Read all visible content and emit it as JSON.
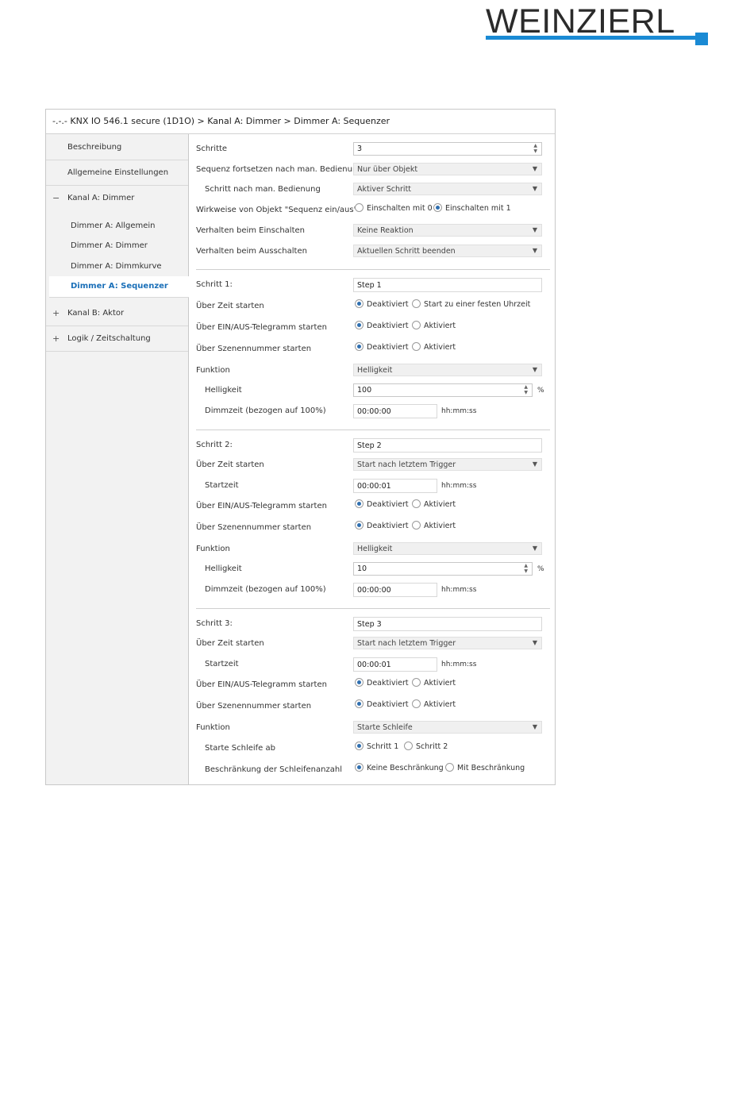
{
  "logo": {
    "text": "WEINZIERL",
    "color": "#1a8ad4"
  },
  "breadcrumb": "-.-.- KNX IO 546.1 secure (1D1O) > Kanal A: Dimmer > Dimmer A: Sequenzer",
  "sidebar": {
    "items": [
      {
        "label": "Beschreibung"
      },
      {
        "label": "Allgemeine Einstellungen"
      },
      {
        "label": "Kanal A: Dimmer",
        "toggle": "−"
      },
      {
        "label": "Dimmer A: Allgemein"
      },
      {
        "label": "Dimmer A: Dimmer"
      },
      {
        "label": "Dimmer A: Dimmkurve"
      },
      {
        "label": "Dimmer A: Sequenzer",
        "active": true
      },
      {
        "label": "Kanal B: Aktor",
        "toggle": "+"
      },
      {
        "label": "Logik / Zeitschaltung",
        "toggle": "+"
      }
    ]
  },
  "radio_labels": {
    "deaktiviert": "Deaktiviert",
    "aktiviert": "Aktiviert",
    "ein0": "Einschalten mit 0",
    "ein1": "Einschalten mit 1",
    "fixtime": "Start zu einer festen Uhrzeit",
    "schritt1": "Schritt 1",
    "schritt2": "Schritt 2",
    "keine": "Keine Beschränkung",
    "mit": "Mit Beschränkung"
  },
  "units": {
    "percent": "%",
    "time": "hh:mm:ss"
  },
  "general": {
    "schritte_label": "Schritte",
    "schritte_value": "3",
    "fortsetzen_label": "Sequenz fortsetzen nach man. Bedienung",
    "fortsetzen_value": "Nur über Objekt",
    "schritt_nach_label": "Schritt nach man. Bedienung",
    "schritt_nach_value": "Aktiver Schritt",
    "wirkweise_label": "Wirkweise von Objekt \"Sequenz ein/aus\"",
    "einschalten_label": "Verhalten beim Einschalten",
    "einschalten_value": "Keine Reaktion",
    "ausschalten_label": "Verhalten beim Ausschalten",
    "ausschalten_value": "Aktuellen Schritt beenden"
  },
  "step1": {
    "name_label": "Schritt 1:",
    "name_value": "Step 1",
    "zeit_label": "Über Zeit starten",
    "ein_aus_label": "Über EIN/AUS-Telegramm starten",
    "szene_label": "Über Szenennummer starten",
    "funktion_label": "Funktion",
    "funktion_value": "Helligkeit",
    "hell_label": "Helligkeit",
    "hell_value": "100",
    "dimm_label": "Dimmzeit (bezogen auf 100%)",
    "dimm_value": "00:00:00"
  },
  "step2": {
    "name_label": "Schritt 2:",
    "name_value": "Step 2",
    "zeit_label": "Über Zeit starten",
    "zeit_value": "Start nach letztem Trigger",
    "start_label": "Startzeit",
    "start_value": "00:00:01",
    "ein_aus_label": "Über EIN/AUS-Telegramm starten",
    "szene_label": "Über Szenennummer starten",
    "funktion_label": "Funktion",
    "funktion_value": "Helligkeit",
    "hell_label": "Helligkeit",
    "hell_value": "10",
    "dimm_label": "Dimmzeit (bezogen auf 100%)",
    "dimm_value": "00:00:00"
  },
  "step3": {
    "name_label": "Schritt 3:",
    "name_value": "Step 3",
    "zeit_label": "Über Zeit starten",
    "zeit_value": "Start nach letztem Trigger",
    "start_label": "Startzeit",
    "start_value": "00:00:01",
    "ein_aus_label": "Über EIN/AUS-Telegramm starten",
    "szene_label": "Über Szenennummer starten",
    "funktion_label": "Funktion",
    "funktion_value": "Starte Schleife",
    "loop_label": "Starte Schleife ab",
    "limit_label": "Beschränkung der Schleifenanzahl"
  }
}
